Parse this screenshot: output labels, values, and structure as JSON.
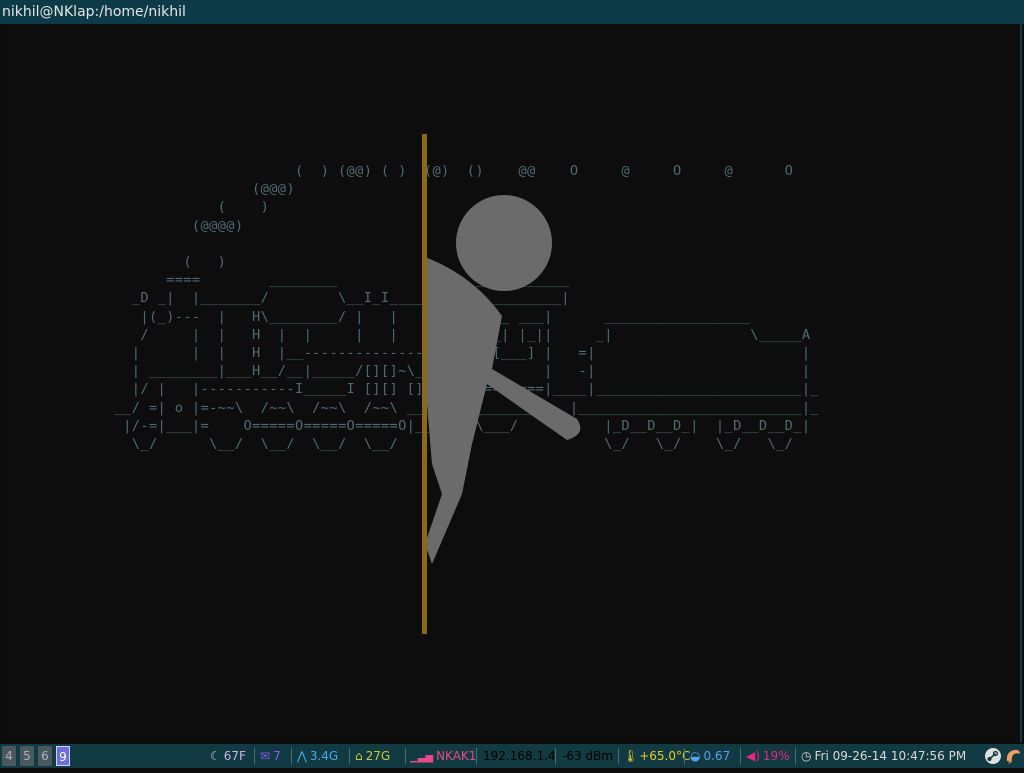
{
  "window": {
    "title": "nikhil@NKlap:/home/nikhil"
  },
  "terminal": {
    "ascii_lines": [
      "                      (  ) (@@) ( )  (@)  ()    @@    O     @     O     @      O",
      "                 (@@@)",
      "             (    )",
      "          (@@@@)",
      "",
      "         (   )",
      "       ====        ________                ___________",
      "   _D _|  |_______/        \\__I_I_____===__|_________|",
      "    |(_)---  |   H\\________/ |   |        =|___ ___|      _________________",
      "    /     |  |   H  |  |     |   |         ||_| |_||     _|                \\_____A",
      "   |      |  |   H  |__--------------------| [___] |   =|                        |",
      "   | ________|___H__/__|_____/[][]~\\_______|       |   -|                        |",
      "   |/ |   |-----------I_____I [][] []  D   |=======|____|________________________|_",
      " __/ =| o |=-~~\\  /~~\\  /~~\\  /~~\\ ____Y___________|__|__________________________|_",
      "  |/-=|___|=    O=====O=====O=====O|_____/~\\___/          |_D__D__D_|  |_D__D__D_|",
      "   \\_/      \\__/  \\__/  \\__/  \\__/      \\_/               \\_/   \\_/    \\_/   \\_/"
    ],
    "colors": {
      "ascii": "#4e6a73",
      "figure": "#6b6b6b",
      "portal_edge": "#8a6a1a"
    }
  },
  "statusbar": {
    "workspaces": [
      {
        "label": "4",
        "active": false
      },
      {
        "label": "5",
        "active": false
      },
      {
        "label": "6",
        "active": false
      },
      {
        "label": "9",
        "active": true
      }
    ],
    "weather": {
      "icon": "moon-icon",
      "value": "67F",
      "color": "#c8b4e6"
    },
    "mail": {
      "icon": "mail-icon",
      "value": "7",
      "color": "#8a5cf0"
    },
    "memory": {
      "icon": "arch-icon",
      "value": "3.4G",
      "color": "#4aa8e8"
    },
    "disk": {
      "icon": "home-icon",
      "value": "27G",
      "color": "#d0c830"
    },
    "wifi": {
      "icon": "signal-icon",
      "value": "NKAK1",
      "color": "#e84a8a"
    },
    "ip": {
      "value": "192.168.1.4",
      "color": "#38e028"
    },
    "signal": {
      "value": "-63 dBm",
      "color": "#e87838"
    },
    "temp": {
      "icon": "thermometer-icon",
      "value": "+65.0°C",
      "color": "#e8c828"
    },
    "load": {
      "icon": "gauge-icon",
      "value": "0.67",
      "color": "#5aa0f0"
    },
    "volume": {
      "icon": "speaker-icon",
      "value": "19%",
      "color": "#e8287a"
    },
    "clock": {
      "icon": "clock-icon",
      "value": "Fri 09-26-14 10:47:56 PM",
      "color": "#d8d8d8"
    },
    "tray": [
      "steam-icon",
      "shrimp-icon"
    ]
  }
}
